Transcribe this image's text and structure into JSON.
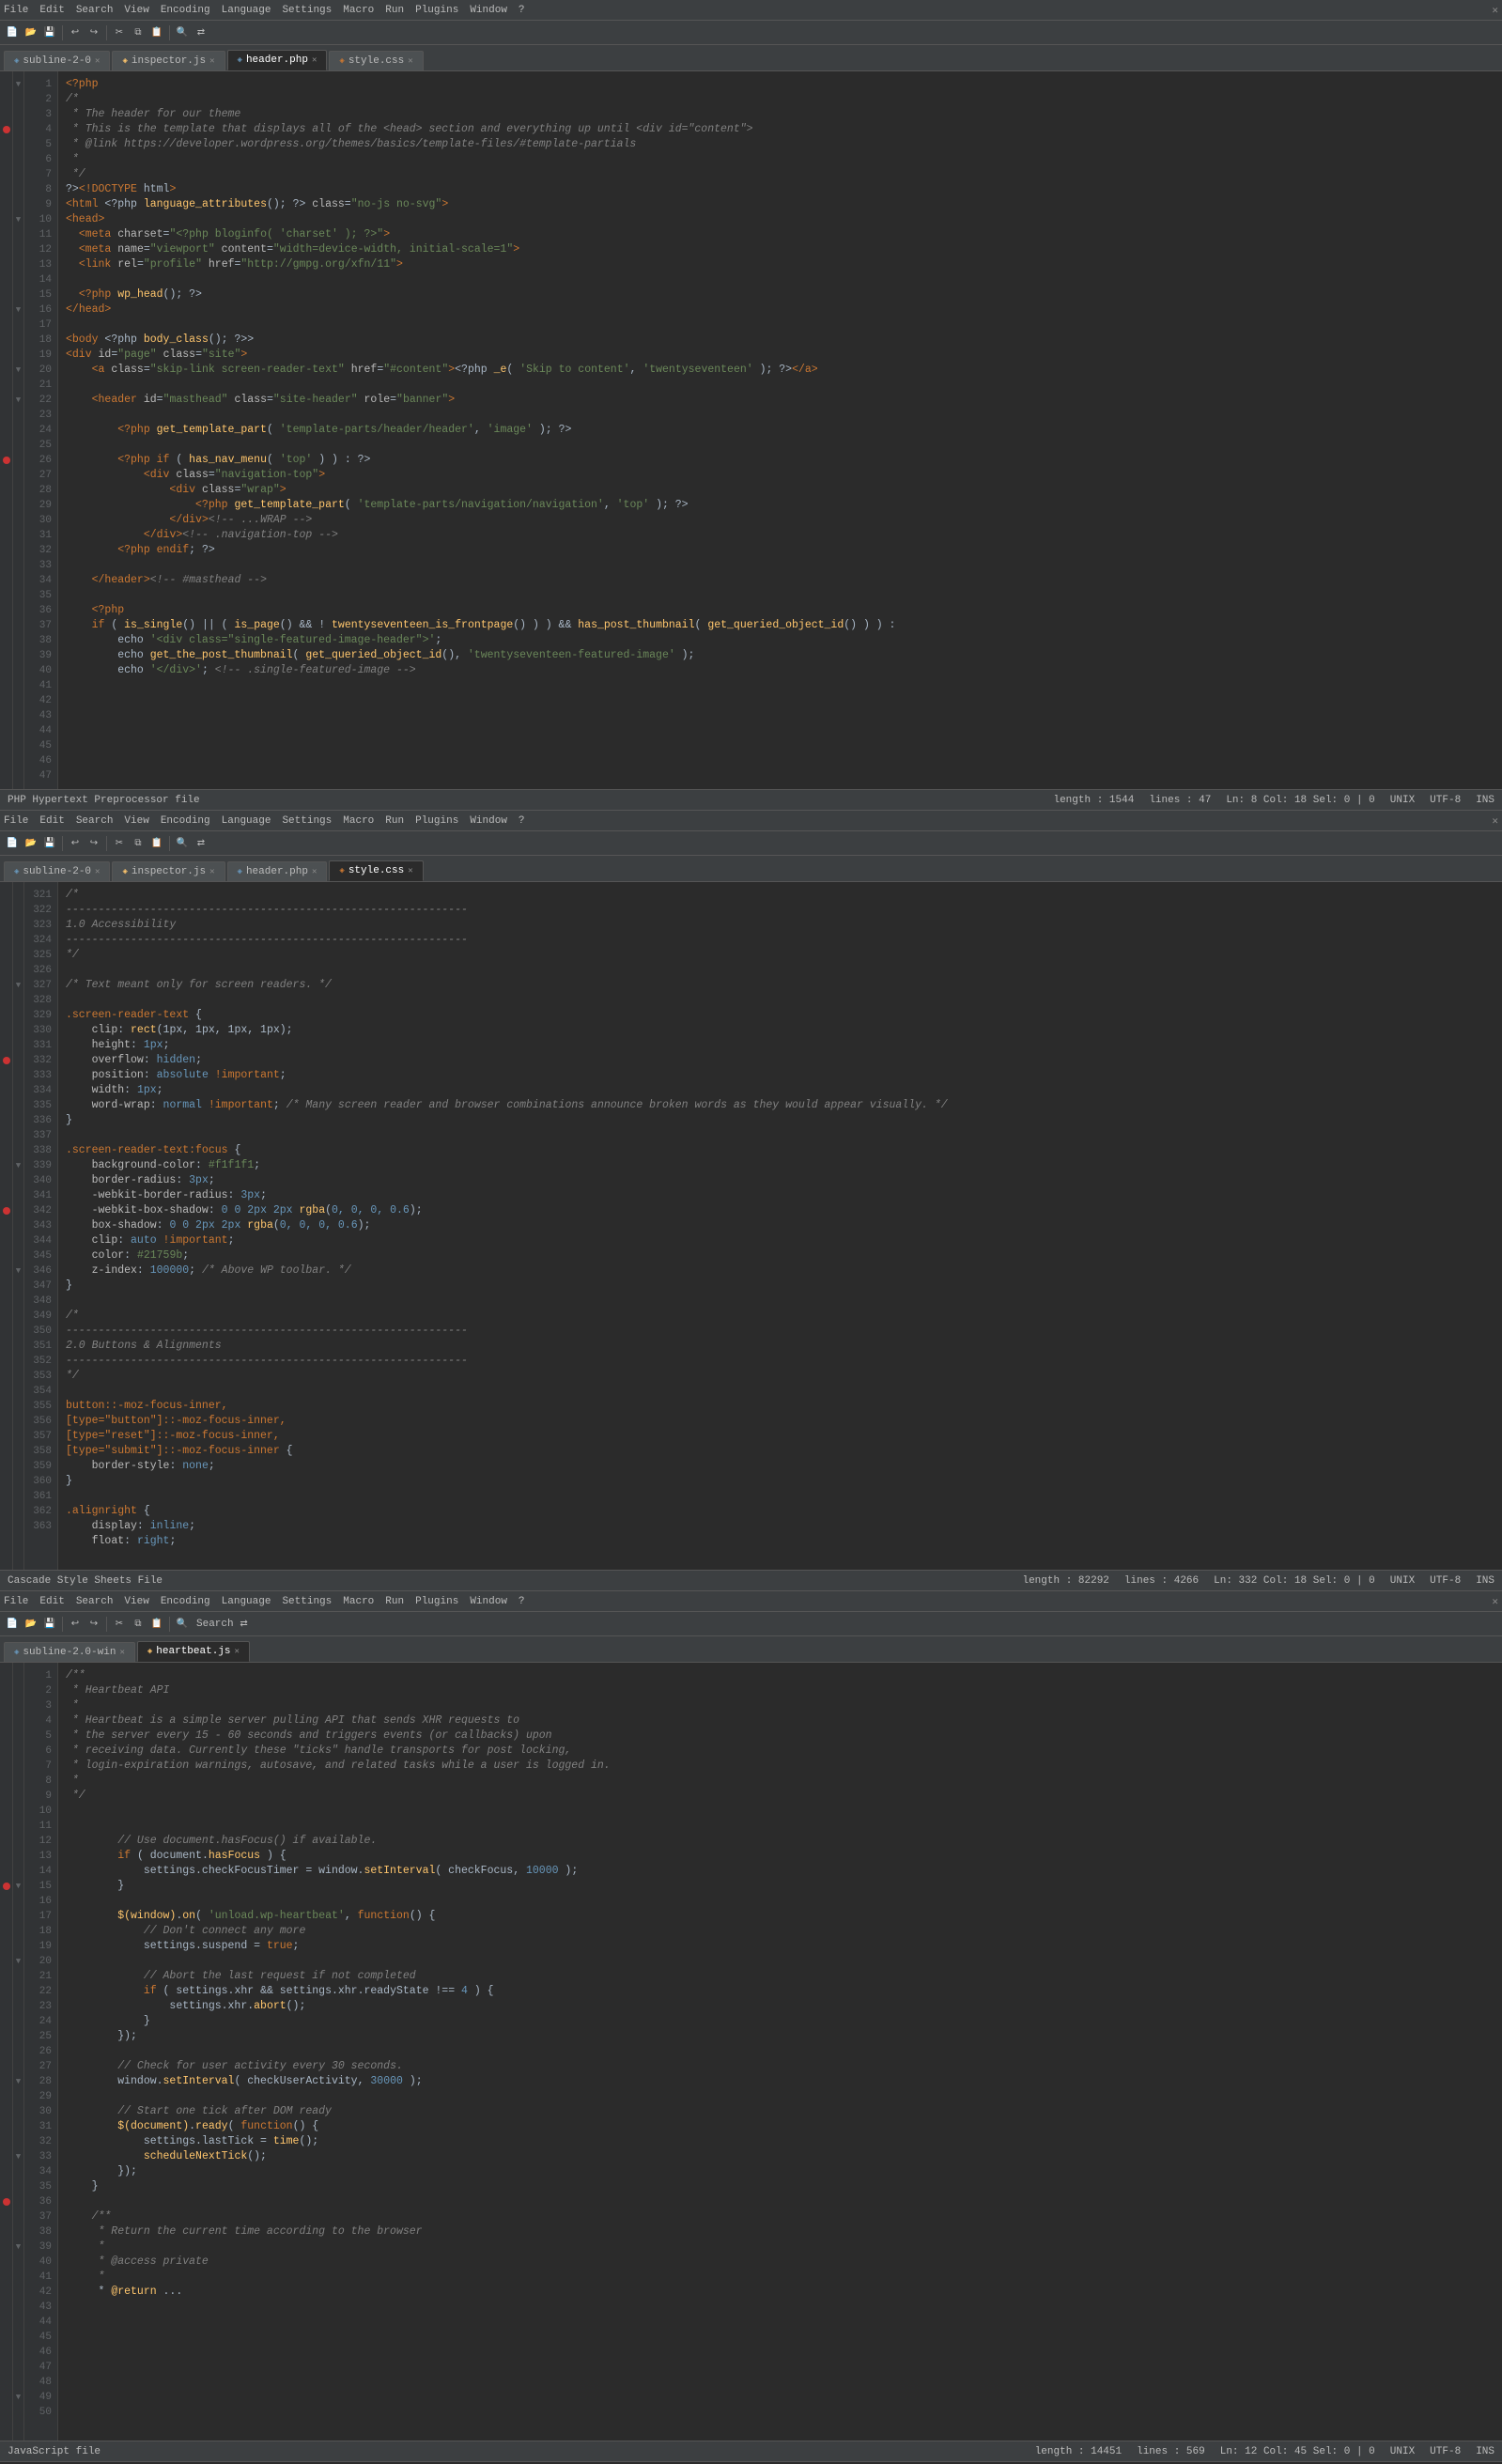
{
  "panels": [
    {
      "id": "panel1",
      "fileType": "PHP Hypertext Preprocessor file",
      "status": {
        "length": "length : 1544",
        "lines": "lines : 47",
        "position": "Ln: 8  Col: 18  Sel: 0 | 0",
        "lineEnding": "UNIX",
        "encoding": "UTF-8",
        "mode": "INS"
      },
      "tabs": [
        {
          "label": "subline-2-0",
          "icon": "php",
          "active": false
        },
        {
          "label": "inspector.js",
          "icon": "js",
          "active": false
        },
        {
          "label": "header.php",
          "icon": "php",
          "active": true
        },
        {
          "label": "style.css",
          "icon": "css",
          "active": false
        }
      ],
      "menuItems": [
        "File",
        "Edit",
        "Search",
        "View",
        "Encoding",
        "Language",
        "Settings",
        "Macro",
        "Run",
        "Plugins",
        "Window",
        "?"
      ]
    },
    {
      "id": "panel2",
      "fileType": "Cascade Style Sheets File",
      "status": {
        "length": "length : 82292",
        "lines": "lines : 4266",
        "position": "Ln: 332  Col: 18  Sel: 0 | 0",
        "lineEnding": "UNIX",
        "encoding": "UTF-8",
        "mode": "INS"
      },
      "tabs": [
        {
          "label": "subline-2-0",
          "icon": "php",
          "active": false
        },
        {
          "label": "inspector.js",
          "icon": "js",
          "active": false
        },
        {
          "label": "header.php",
          "icon": "php",
          "active": false
        },
        {
          "label": "style.css",
          "icon": "css",
          "active": true
        }
      ],
      "menuItems": [
        "File",
        "Edit",
        "Search",
        "View",
        "Encoding",
        "Language",
        "Settings",
        "Macro",
        "Run",
        "Plugins",
        "Window",
        "?"
      ]
    },
    {
      "id": "panel3",
      "fileType": "JavaScript file",
      "status": {
        "length": "length : 14451",
        "lines": "lines : 569",
        "position": "Ln: 12  Col: 45  Sel: 0 | 0",
        "lineEnding": "UNIX",
        "encoding": "UTF-8",
        "mode": "INS"
      },
      "tabs": [
        {
          "label": "subline-2.0-win",
          "icon": "php",
          "active": false
        },
        {
          "label": "heartbeat.js",
          "icon": "js",
          "active": true
        }
      ],
      "menuItems": [
        "File",
        "Edit",
        "Search",
        "View",
        "Encoding",
        "Language",
        "Settings",
        "Macro",
        "Run",
        "Plugins",
        "Window",
        "?"
      ]
    }
  ]
}
